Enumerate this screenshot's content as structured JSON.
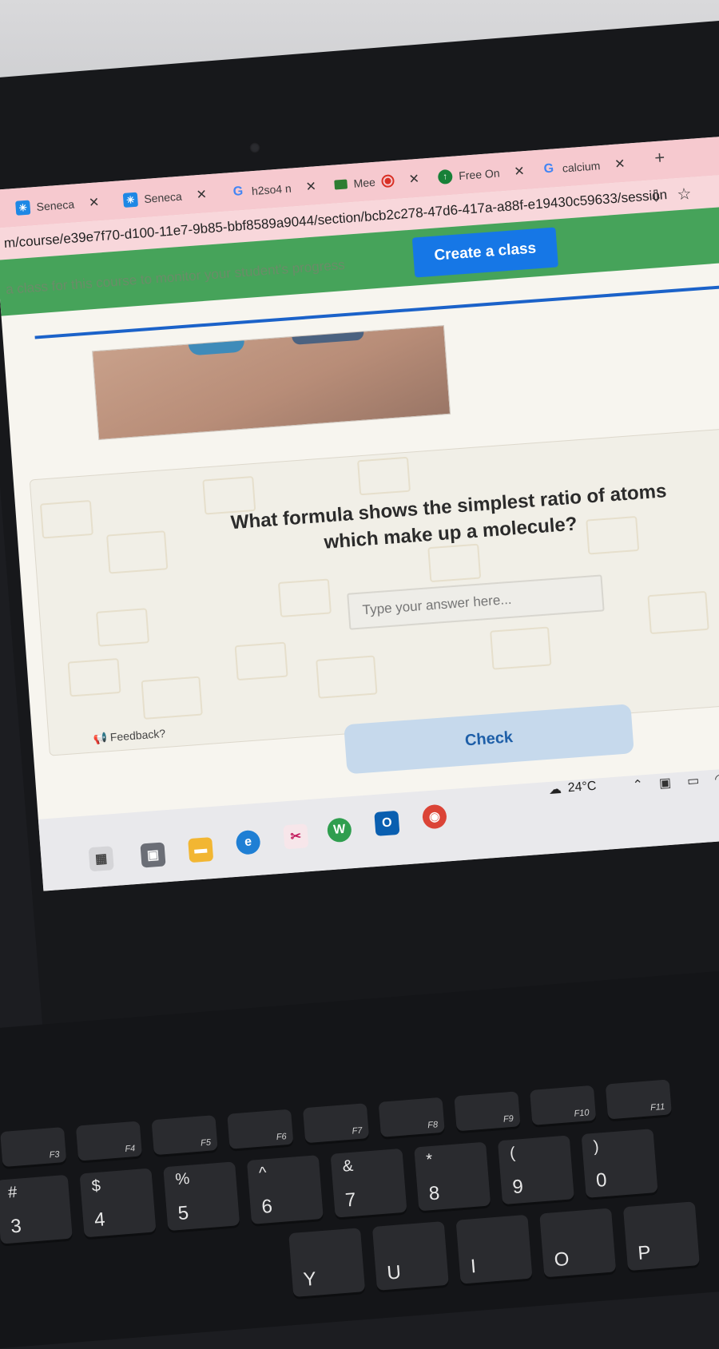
{
  "browser": {
    "tabs": [
      {
        "label": "Seneca",
        "icon": "seneca-icon"
      },
      {
        "label": "Seneca",
        "icon": "seneca-icon"
      },
      {
        "label": "h2so4 n",
        "icon": "google-icon"
      },
      {
        "label": "Mee",
        "icon": "meet-icon"
      },
      {
        "label": "Free On",
        "icon": "free-icon"
      },
      {
        "label": "calcium",
        "icon": "google-icon"
      }
    ],
    "new_tab": "+",
    "url": "m/course/e39e7f70-d100-11e7-9b85-bbf8589a9044/section/bcb2c278-47d6-417a-a88f-e19430c59633/session"
  },
  "banner": {
    "text": "a class for this course to monitor your student's progress",
    "button": "Create a class"
  },
  "question": {
    "text": "What formula shows the simplest ratio of atoms which make up a molecule?",
    "placeholder": "Type your answer here...",
    "feedback": "Feedback?",
    "check": "Check"
  },
  "taskbar": {
    "temperature": "24°C"
  },
  "keyboard": {
    "fkeys": [
      "F3",
      "F4",
      "F5",
      "F6",
      "F7",
      "F8",
      "F9",
      "F10",
      "F11"
    ],
    "numrow": [
      {
        "top": "#",
        "bot": "3"
      },
      {
        "top": "$",
        "bot": "4"
      },
      {
        "top": "%",
        "bot": "5"
      },
      {
        "top": "^",
        "bot": "6"
      },
      {
        "top": "&",
        "bot": "7"
      },
      {
        "top": "*",
        "bot": "8"
      },
      {
        "top": "(",
        "bot": "9"
      },
      {
        "top": ")",
        "bot": "0"
      }
    ],
    "letters": [
      "Y",
      "U",
      "I",
      "O",
      "P"
    ]
  },
  "colors": {
    "banner": "#46a35a",
    "create_button": "#1677e6",
    "check_button": "#c6d9ec",
    "tabbar": "#f6c9cf"
  }
}
